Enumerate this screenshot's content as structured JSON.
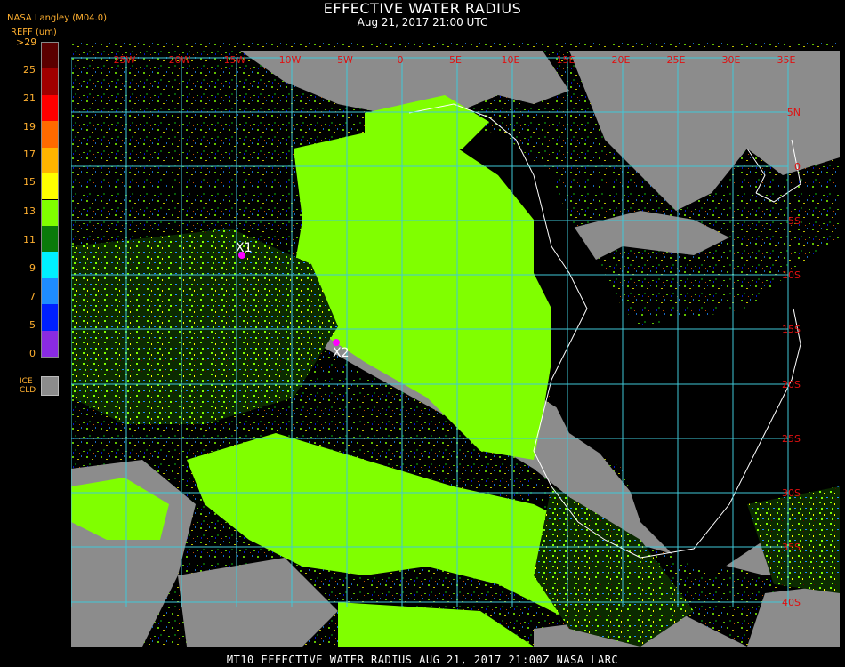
{
  "header": {
    "title": "EFFECTIVE WATER RADIUS",
    "subtitle": "Aug 21, 2017 21:00 UTC",
    "producer": "NASA Langley (M04.0)",
    "units": "REFF (um)"
  },
  "legend": {
    "ticks": [
      ">29",
      "25",
      "21",
      "19",
      "17",
      "15",
      "13",
      "11",
      "9",
      "7",
      "5",
      "0"
    ],
    "colors": [
      "#5a0000",
      "#a00000",
      "#ff0000",
      "#ff6a00",
      "#ffb400",
      "#ffff00",
      "#80ff00",
      "#0a7a0a",
      "#00f0ff",
      "#1e8cff",
      "#0020ff",
      "#8a2be2"
    ],
    "ice_label_1": "ICE",
    "ice_label_2": "CLD",
    "ice_color": "#8c8c8c"
  },
  "map": {
    "lon_labels": [
      "25W",
      "20W",
      "15W",
      "10W",
      "5W",
      "0",
      "5E",
      "10E",
      "15E",
      "20E",
      "25E",
      "30E",
      "35E"
    ],
    "lat_labels": [
      "5N",
      "0",
      "5S",
      "10S",
      "15S",
      "20S",
      "25S",
      "30S",
      "35S",
      "40S"
    ],
    "markers": [
      {
        "label": "X1",
        "color": "#ff00ff"
      },
      {
        "label": "X2",
        "color": "#ff00ff"
      }
    ],
    "grid_color": "#40c8d8",
    "label_color": "#e01010"
  },
  "footer": {
    "text": "MT10  EFFECTIVE WATER RADIUS   AUG 21, 2017 21:00Z   NASA LARC"
  }
}
